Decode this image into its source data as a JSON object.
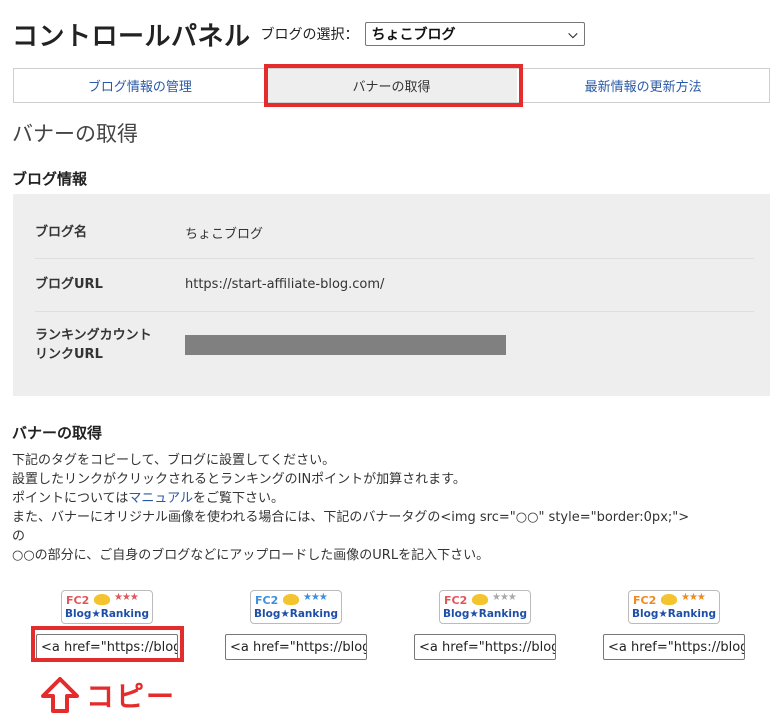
{
  "header": {
    "title": "コントロールパネル",
    "blog_select_label": "ブログの選択：",
    "blog_select_value": "ちょこブログ"
  },
  "tabs": [
    {
      "label": "ブログ情報の管理",
      "active": false
    },
    {
      "label": "バナーの取得",
      "active": true
    },
    {
      "label": "最新情報の更新方法",
      "active": false
    }
  ],
  "section_title": "バナーの取得",
  "blog_info": {
    "heading": "ブログ情報",
    "rows": [
      {
        "label": "ブログ名",
        "value": "ちょこブログ"
      },
      {
        "label": "ブログURL",
        "value": "https://start-affiliate-blog.com/"
      },
      {
        "label_line1": "ランキングカウント",
        "label_line2": "リンクURL",
        "value": ""
      }
    ]
  },
  "banner_section": {
    "heading": "バナーの取得",
    "lines": [
      "下記のタグをコピーして、ブログに設置してください。",
      "設置したリンクがクリックされるとランキングのINポイントが加算されます。"
    ],
    "manual_prefix": "ポイントについては",
    "manual_link": "マニュアル",
    "manual_suffix": "をご覧下さい。",
    "line4": "また、バナーにオリジナル画像を使われる場合には、下記のバナータグの<img src=\"○○\" style=\"border:0px;\">",
    "line5": "の",
    "line6": "○○の部分に、ご自身のブログなどにアップロードした画像のURLを記入下さい。"
  },
  "banners": [
    {
      "fc2": "FC2",
      "text": "Blog★Ranking",
      "accent": "#e0575b",
      "code": "<a href=\"https://blog"
    },
    {
      "fc2": "FC2",
      "text": "Blog★Ranking",
      "accent": "#3d8fe0",
      "code": "<a href=\"https://blog"
    },
    {
      "fc2": "FC2",
      "text": "Blog★Ranking",
      "accent": "#e0575b",
      "code": "<a href=\"https://blog"
    },
    {
      "fc2": "FC2",
      "text": "Blog★Ranking",
      "accent": "#f08a1c",
      "code": "<a href=\"https://blog"
    }
  ],
  "annotation": {
    "copy_label": "コピー",
    "highlight_color": "#e52c2c"
  }
}
